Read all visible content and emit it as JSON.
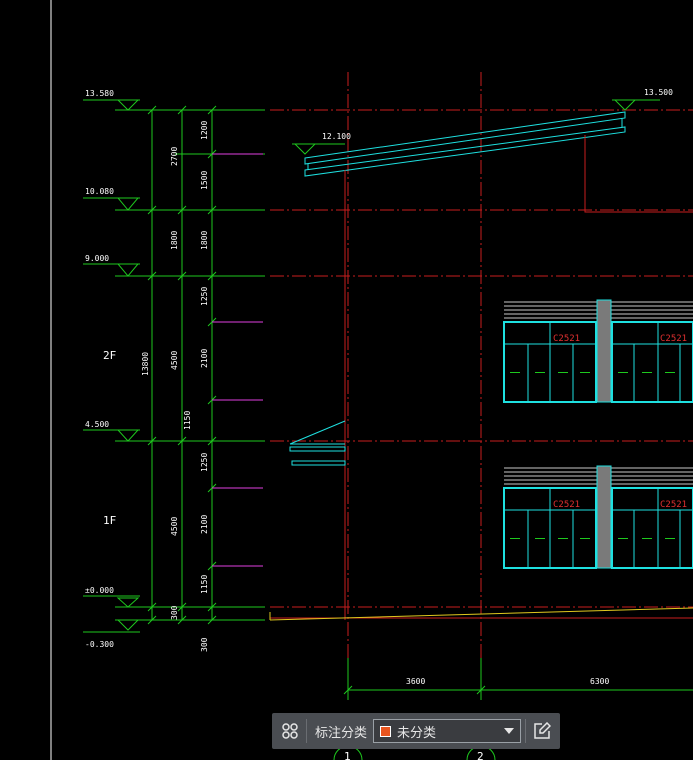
{
  "drawing": {
    "elevations": {
      "e13580": "13.580",
      "e12100": "12.100",
      "e10080": "10.080",
      "e9000": "9.000",
      "e4500": "4.500",
      "e0": "±0.000",
      "eneg300": "-0.300",
      "e13500": "13.500"
    },
    "floors": {
      "f2": "2F",
      "f1": "1F"
    },
    "dims": {
      "d13800": "13800",
      "d2700": "2700",
      "d1800a": "1800",
      "d4500a": "4500",
      "d4500b": "4500",
      "d300a": "300",
      "d1200": "1200",
      "d1500": "1500",
      "d1800b": "1800",
      "d1250a": "1250",
      "d2100a": "2100",
      "d1150a": "1150",
      "d1250b": "1250",
      "d2100b": "2100",
      "d1150b": "1150",
      "d300b": "300",
      "d3600": "3600",
      "d6300": "6300"
    },
    "windows": {
      "w_label": "C2521"
    },
    "grid": {
      "g1": "1",
      "g2": "2"
    }
  },
  "toolbar": {
    "grid_icon": "grid-icon",
    "label": "标注分类",
    "select_value": "未分类",
    "select_color": "#e8541e",
    "edit_icon": "edit-icon"
  }
}
